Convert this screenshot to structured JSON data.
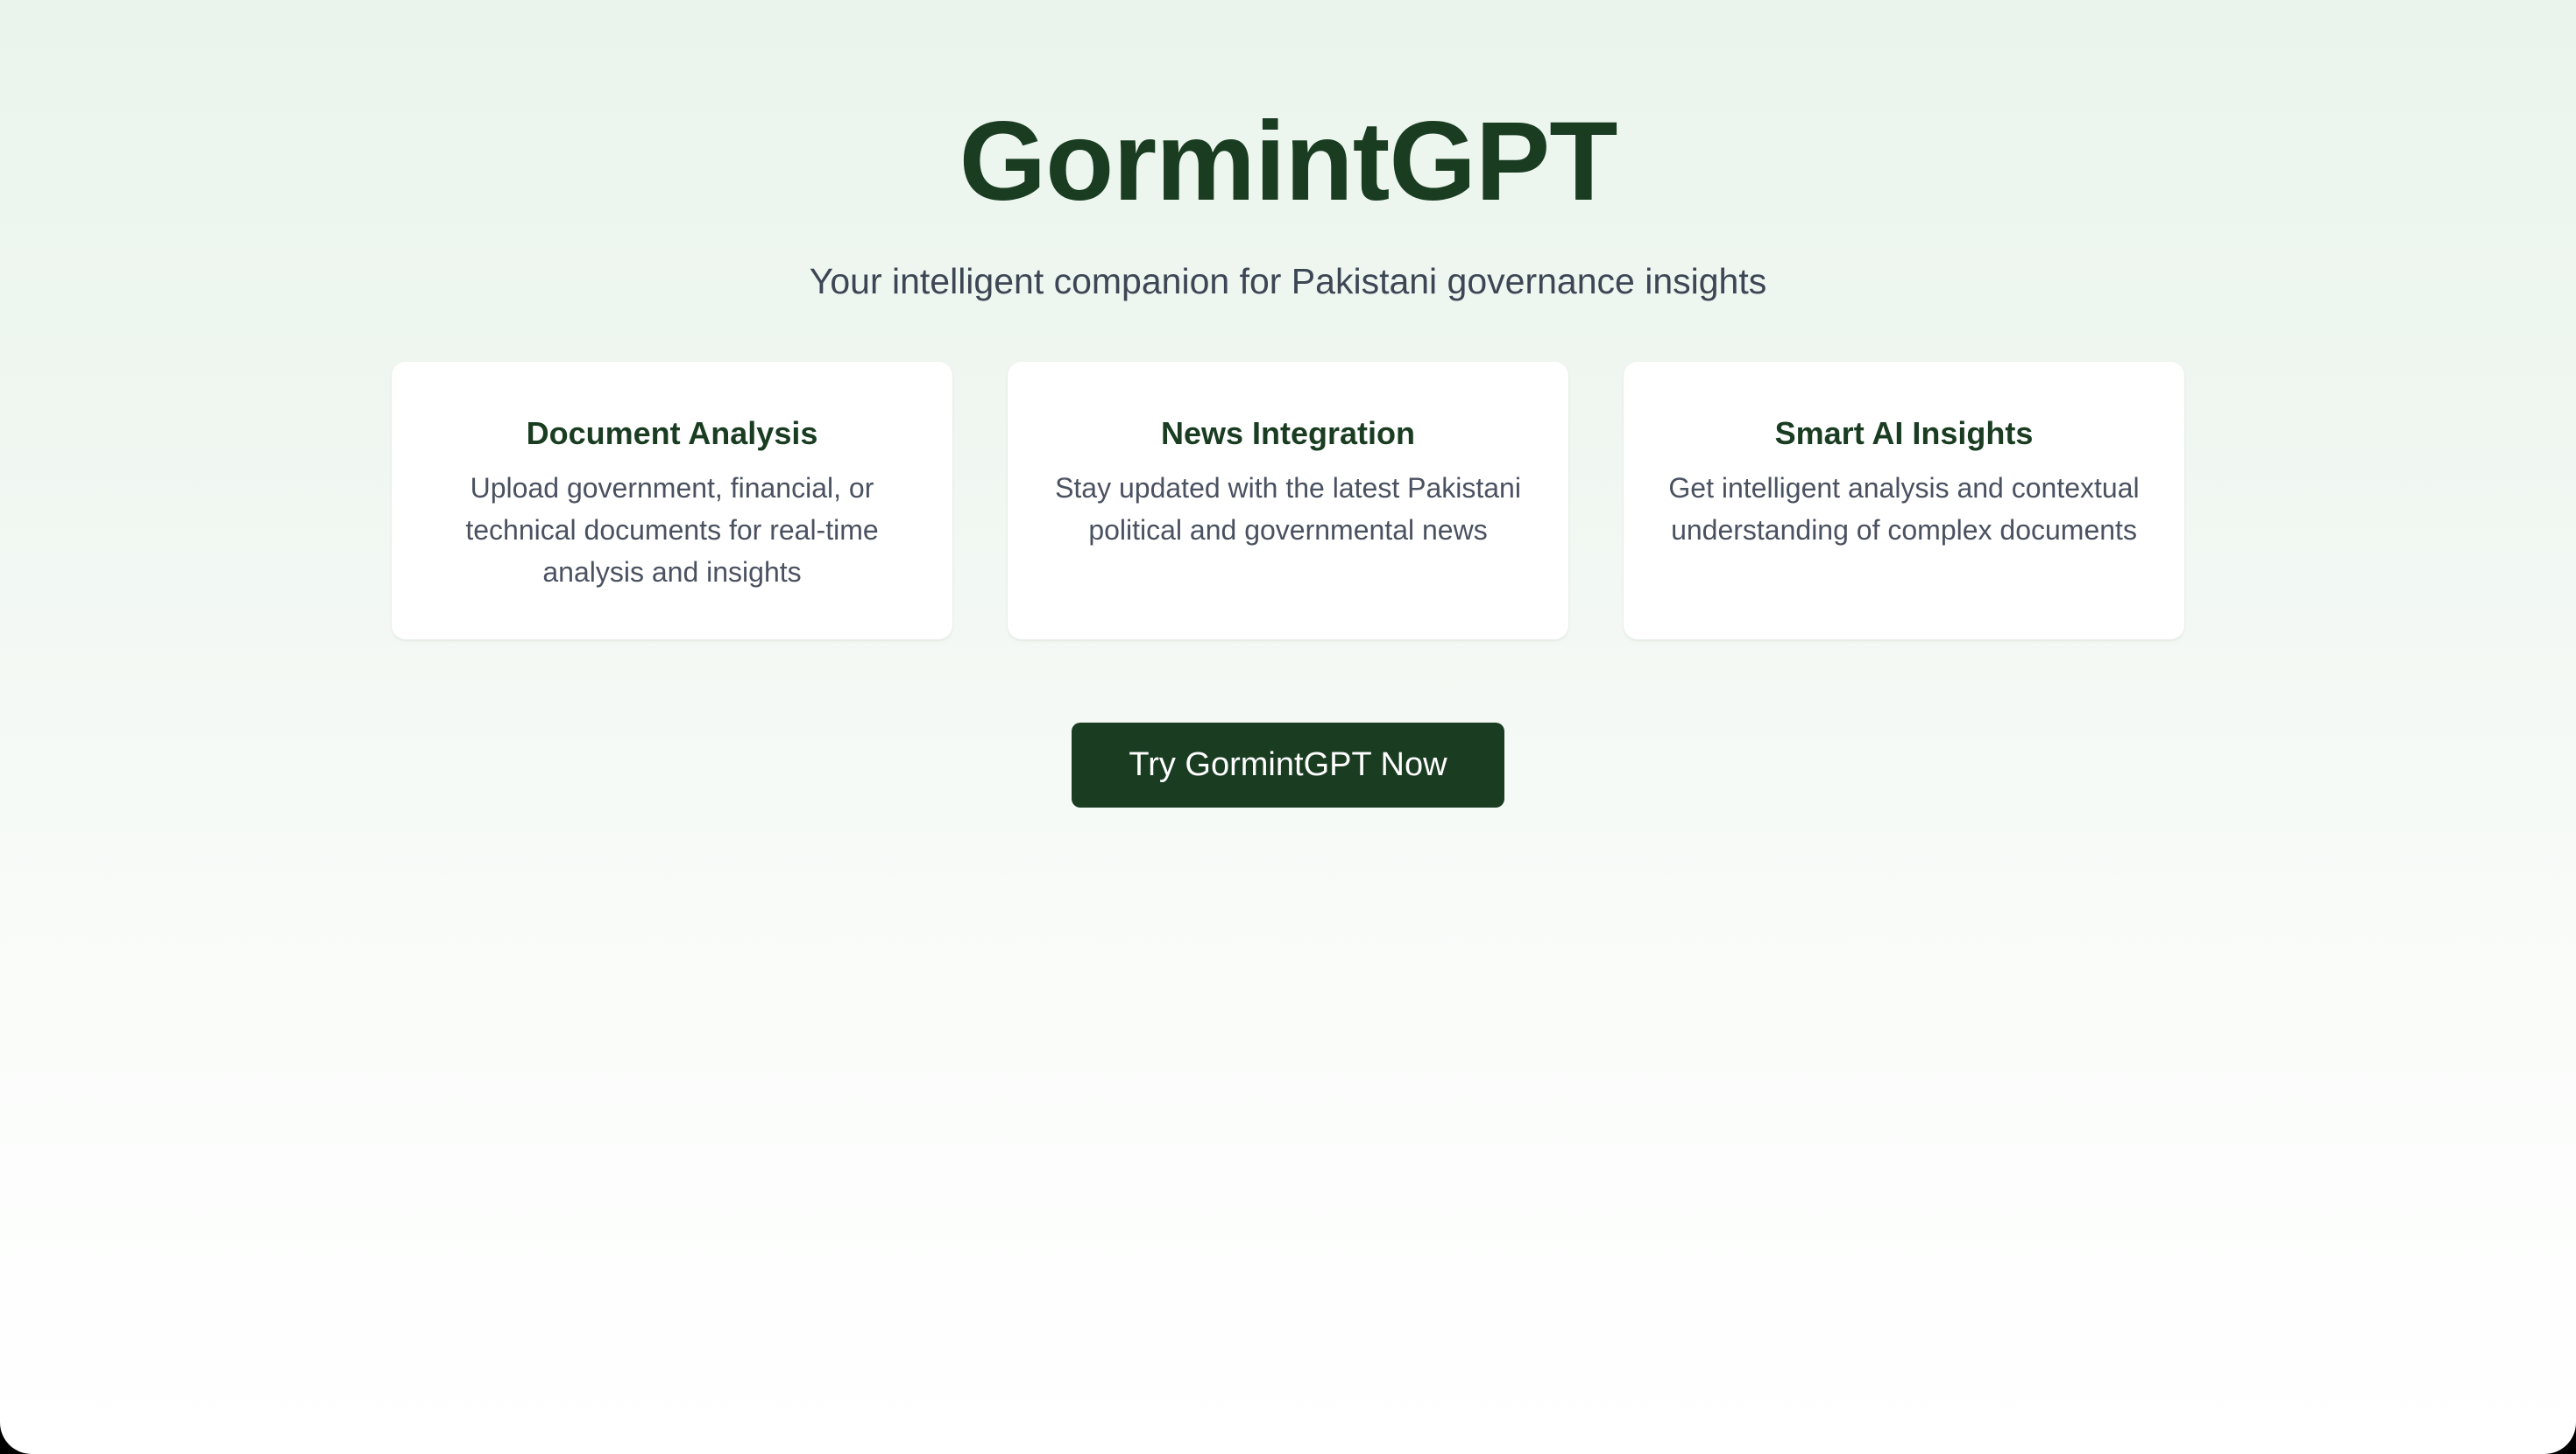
{
  "hero": {
    "title": "GormintGPT",
    "subtitle": "Your intelligent companion for Pakistani governance insights"
  },
  "features": [
    {
      "title": "Document Analysis",
      "description": "Upload government, financial, or technical documents for real-time analysis and insights"
    },
    {
      "title": "News Integration",
      "description": "Stay updated with the latest Pakistani political and governmental news"
    },
    {
      "title": "Smart AI Insights",
      "description": "Get intelligent analysis and contextual understanding of complex documents"
    }
  ],
  "cta": {
    "label": "Try GormintGPT Now"
  },
  "colors": {
    "brand": "#1a3d22",
    "text_muted": "#4a5160",
    "card_bg": "#ffffff",
    "page_bg_top": "#eaf4ec",
    "page_bg_bottom": "#ffffff"
  }
}
